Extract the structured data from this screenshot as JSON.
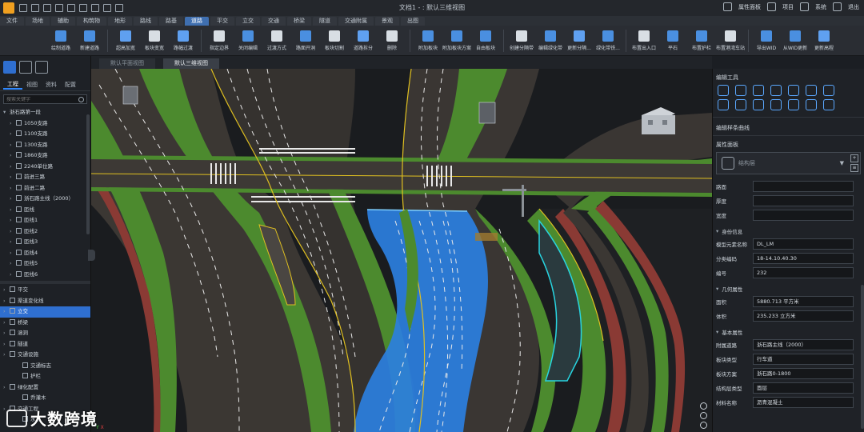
{
  "titlebar": {
    "doc_title": "文档1 - : 默认三维视图",
    "right_items": [
      "属性面板",
      "项目",
      "系统",
      "退出"
    ]
  },
  "menu_tabs": [
    "文件",
    "场地",
    "辅助",
    "构筑物",
    "地形",
    "路线",
    "路基",
    "道路",
    "平交",
    "立交",
    "交通",
    "桥梁",
    "隧道",
    "交通附属",
    "景观",
    "出图"
  ],
  "menu_active": "道路",
  "ribbon": {
    "buttons": [
      {
        "label": "绘制道路",
        "color": "#4a8fe0"
      },
      {
        "label": "新建道路",
        "color": "#4a8fe0"
      },
      {
        "label": "超高加宽",
        "color": "#5fa0f0"
      },
      {
        "label": "板块变宽",
        "color": "#d8dee4"
      },
      {
        "label": "路幅过渡",
        "color": "#5fa0f0"
      },
      {
        "label": "指定边界",
        "color": "#d8dee4"
      },
      {
        "label": "关闭编辑",
        "color": "#4a8fe0"
      },
      {
        "label": "过渡方式",
        "color": "#d8dee4"
      },
      {
        "label": "路面开洞",
        "color": "#4a8fe0"
      },
      {
        "label": "板块切割",
        "color": "#d8dee4"
      },
      {
        "label": "道路拆分",
        "color": "#5fa0f0"
      },
      {
        "label": "删除",
        "color": "#d8dee4"
      },
      {
        "label": "附加板块",
        "color": "#4a8fe0"
      },
      {
        "label": "附加板块方案",
        "color": "#4a8fe0"
      },
      {
        "label": "自由板块",
        "color": "#4a8fe0"
      },
      {
        "label": "创建分隔带",
        "color": "#d8dee4"
      },
      {
        "label": "编辑绿化带",
        "color": "#4a8fe0"
      },
      {
        "label": "更新分隔...",
        "color": "#5fa0f0"
      },
      {
        "label": "绿化带铁...",
        "color": "#4a8fe0"
      },
      {
        "label": "布置出入口",
        "color": "#d8dee4"
      },
      {
        "label": "平石",
        "color": "#4a8fe0"
      },
      {
        "label": "布置护栏",
        "color": "#4a8fe0"
      },
      {
        "label": "布置港湾车站",
        "color": "#d8dee4"
      },
      {
        "label": "导出WID",
        "color": "#4a8fe0"
      },
      {
        "label": "从WID更新",
        "color": "#4a8fe0"
      },
      {
        "label": "更新高程",
        "color": "#5fa0f0"
      }
    ]
  },
  "view_tabs": [
    "默认平面视图",
    "默认三维视图"
  ],
  "view_active": 1,
  "left_panel": {
    "tabs": [
      "工程",
      "视图",
      "资料",
      "配置"
    ],
    "active_tab": "工程",
    "search_placeholder": "搜索关键字",
    "tree_root": "浙石路第一段",
    "tree_items": [
      "1050支路",
      "1100支路",
      "1300支路",
      "1860支路",
      "2240单位路",
      "前进三路",
      "前进二路",
      "浙石路主线（2000）",
      "匝线",
      "匝线1",
      "匝线2",
      "匝线3",
      "匝线4",
      "匝线5",
      "匝线6"
    ],
    "lower_items": [
      {
        "label": "平交",
        "level": 0
      },
      {
        "label": "渠道变化线",
        "level": 0
      },
      {
        "label": "立交",
        "level": 0,
        "selected": true
      },
      {
        "label": "桥梁",
        "level": 0
      },
      {
        "label": "涵洞",
        "level": 0
      },
      {
        "label": "隧道",
        "level": 0
      },
      {
        "label": "交通设施",
        "level": 0
      },
      {
        "label": "交通标志",
        "level": 1
      },
      {
        "label": "护栏",
        "level": 1
      },
      {
        "label": "绿化配置",
        "level": 0
      },
      {
        "label": "乔灌木",
        "level": 1
      },
      {
        "label": "交通工程",
        "level": 0
      },
      {
        "label": "水系",
        "level": 1
      }
    ]
  },
  "right_panel": {
    "edit_tools_title": "编辑工具",
    "edit_subtitle": "编辑样条曲线",
    "props_title": "属性面板",
    "combo_text": "结构层",
    "blank_fields": [
      "路面",
      "厚度",
      "宽度"
    ],
    "group_identity": "身份信息",
    "identity": [
      {
        "label": "模型元素名称",
        "value": "DL_LM"
      },
      {
        "label": "分类编码",
        "value": "18-14.10.40.30"
      },
      {
        "label": "编号",
        "value": "232"
      }
    ],
    "group_geometry": "几何属性",
    "geometry": [
      {
        "label": "面积",
        "value": "5880.713 平方米"
      },
      {
        "label": "体积",
        "value": "235.233 立方米"
      }
    ],
    "group_basic": "基本属性",
    "basic": [
      {
        "label": "附属道路",
        "value": "浙石路主线（2000）"
      },
      {
        "label": "板块类型",
        "value": "行车道"
      },
      {
        "label": "板块方案",
        "value": "浙石路0-1800"
      },
      {
        "label": "结构层类型",
        "value": "面层"
      },
      {
        "label": "材料名称",
        "value": "沥青混凝土"
      }
    ]
  },
  "watermark": "大数跨境",
  "colors": {
    "accent": "#2f6fd0",
    "road": "#3a3633",
    "green_strip": "#4c8a2e",
    "red_strip": "#8a3a34",
    "selected_surface": "#2b7fe0",
    "lane_marking": "#e8e8e8",
    "yellow_line": "#e0c020"
  }
}
